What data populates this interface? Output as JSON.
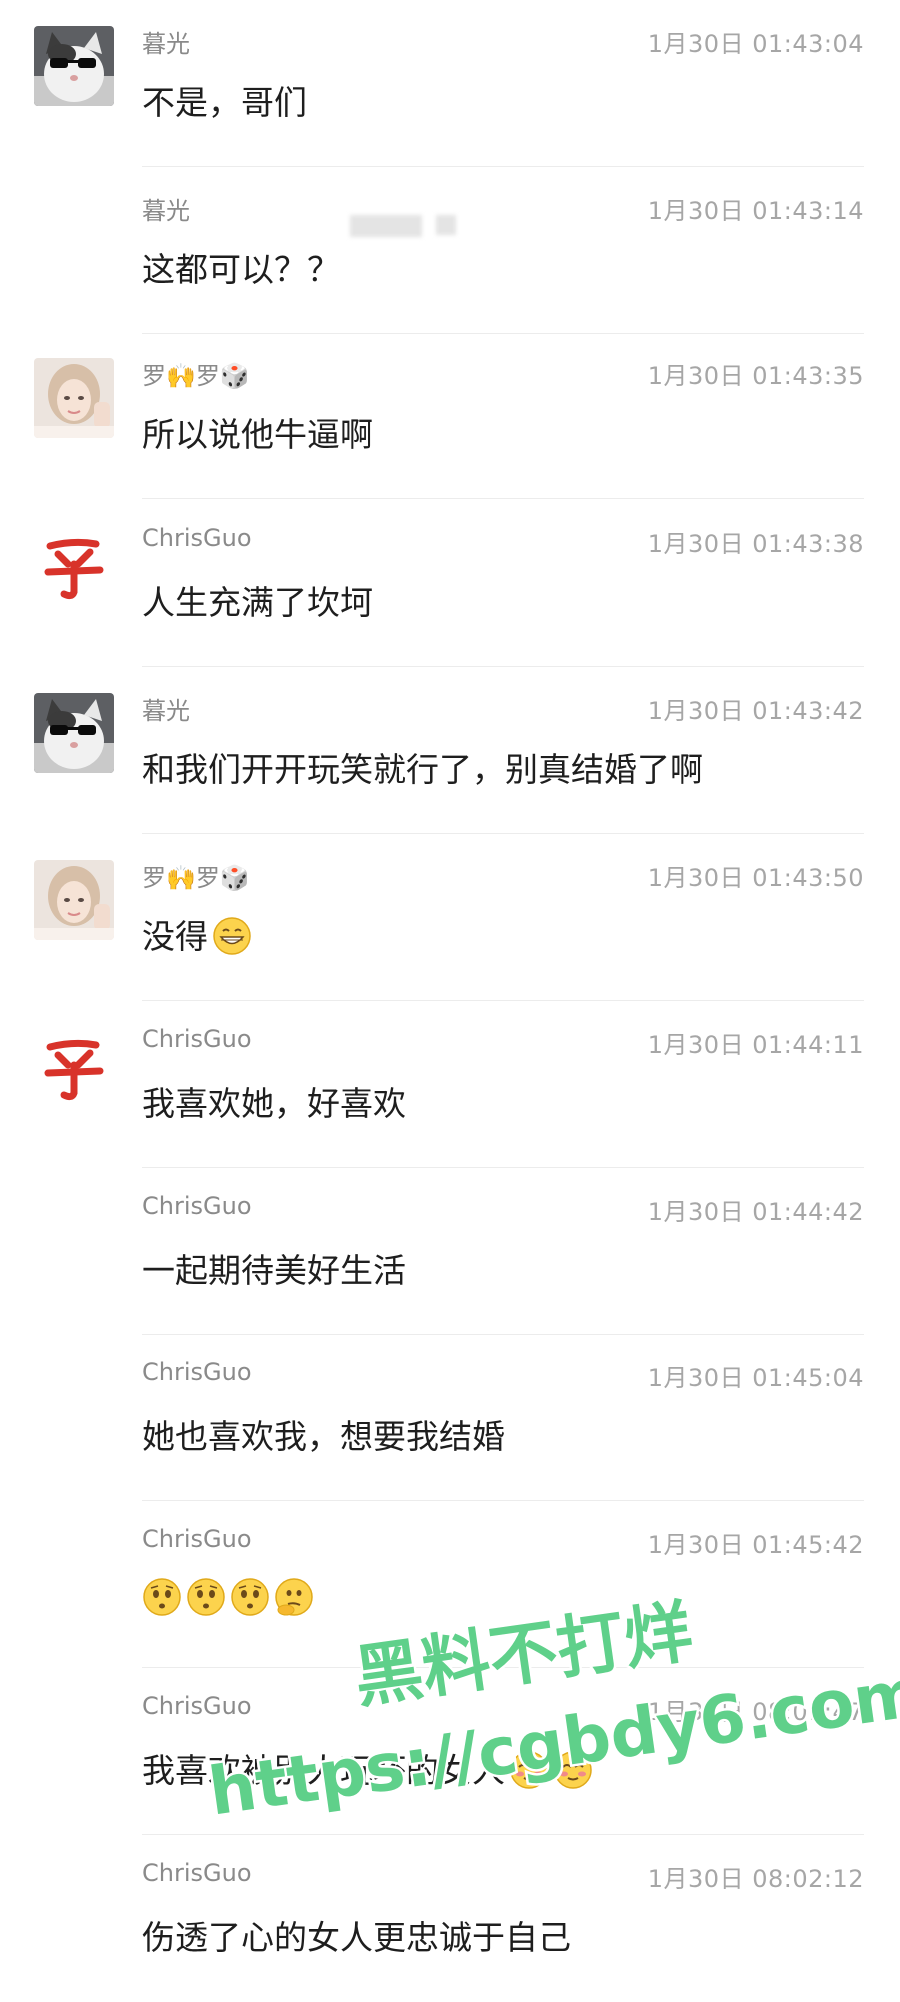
{
  "messages": [
    {
      "name": "暮光",
      "time": "1月30日 01:43:04",
      "text": "不是，哥们",
      "avatar": "cat-sunglasses-avatar"
    },
    {
      "name": "暮光",
      "time": "1月30日 01:43:14",
      "text": "这都可以？？",
      "avatar": ""
    },
    {
      "name": "罗🙌罗🎲",
      "time": "1月30日 01:43:35",
      "text": "所以说他牛逼啊",
      "avatar": "girl-avatar"
    },
    {
      "name": "ChrisGuo",
      "time": "1月30日 01:43:38",
      "text": "人生充满了坎坷",
      "avatar": "red-glyph-avatar"
    },
    {
      "name": "暮光",
      "time": "1月30日 01:43:42",
      "text": "和我们开开玩笑就行了，别真结婚了啊",
      "avatar": "cat-sunglasses-avatar"
    },
    {
      "name": "罗🙌罗🎲",
      "time": "1月30日 01:43:50",
      "text": "没得",
      "avatar": "girl-avatar",
      "emoji": [
        "grin"
      ]
    },
    {
      "name": "ChrisGuo",
      "time": "1月30日 01:44:11",
      "text": "我喜欢她，好喜欢",
      "avatar": "red-glyph-avatar"
    },
    {
      "name": "ChrisGuo",
      "time": "1月30日 01:44:42",
      "text": "一起期待美好生活",
      "avatar": ""
    },
    {
      "name": "ChrisGuo",
      "time": "1月30日 01:45:04",
      "text": "她也喜欢我，想要我结婚",
      "avatar": ""
    },
    {
      "name": "ChrisGuo",
      "time": "1月30日 01:45:42",
      "text": "",
      "avatar": "",
      "emoji": [
        "worried",
        "worried",
        "worried",
        "thinking"
      ]
    },
    {
      "name": "ChrisGuo",
      "time": "1月30日 08:01:47",
      "text": "我喜欢被别人玩坏的女人",
      "avatar": "",
      "emoji": [
        "shy",
        "shy"
      ]
    },
    {
      "name": "ChrisGuo",
      "time": "1月30日 08:02:12",
      "text": "伤透了心的女人更忠诚于自己",
      "avatar": ""
    }
  ],
  "watermark": {
    "line1": "黑料不打烊",
    "line2": "https://cgbdy6.com",
    "color": "#5fd08a"
  },
  "colors": {
    "name": "#8a8a8a",
    "time": "#a6a6a6",
    "text": "#1e1e1e",
    "glyph": "#d8332a"
  }
}
